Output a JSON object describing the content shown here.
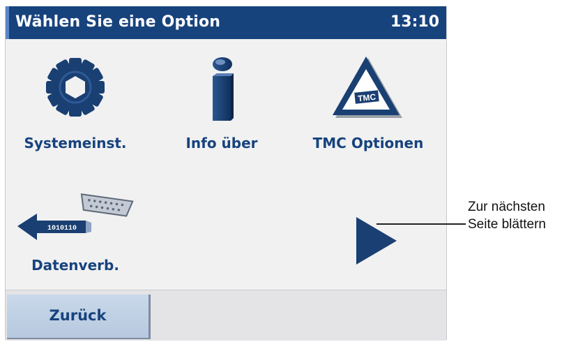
{
  "header": {
    "title": "Wählen Sie eine Option",
    "time": "13:10"
  },
  "menu": {
    "items": [
      {
        "label": "Systemeinst.",
        "icon": "gear-icon"
      },
      {
        "label": "Info über",
        "icon": "info-icon"
      },
      {
        "label": "TMC Optionen",
        "icon": "tmc-warning-triangle-icon",
        "icon_text": "TMC"
      },
      {
        "label": "Datenverb.",
        "icon": "data-connection-icon",
        "icon_text": "1010110"
      }
    ]
  },
  "navigation": {
    "next_icon": "play-arrow-icon"
  },
  "footer": {
    "back_label": "Zurück"
  },
  "annotation": {
    "line1": "Zur nächsten",
    "line2": "Seite blättern"
  },
  "colors": {
    "title_bar": "#17437d",
    "accent": "#5a86c6",
    "label_text": "#17437d",
    "background": "#f1f1f2",
    "button": "#c2d3e7"
  }
}
